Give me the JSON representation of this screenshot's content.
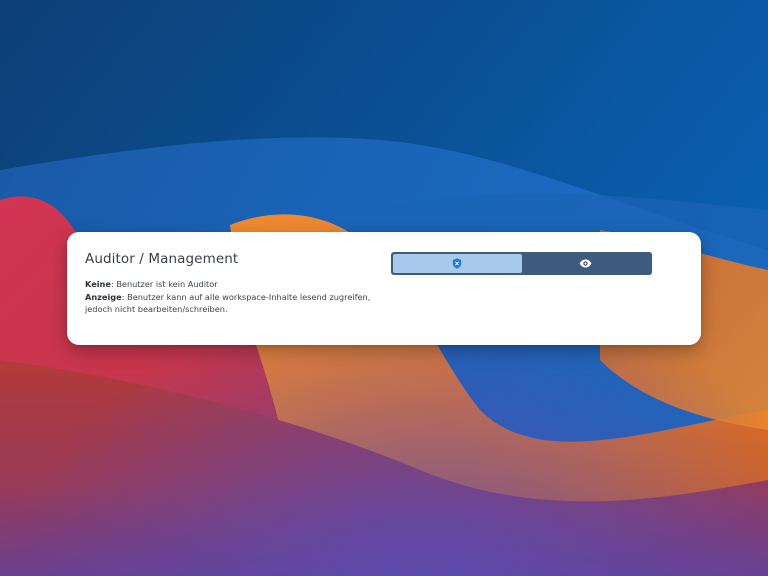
{
  "card": {
    "title": "Auditor / Management",
    "options": [
      {
        "term": "Keine",
        "description": ": Benutzer ist kein Auditor"
      },
      {
        "term": "Anzeige",
        "description": ": Benutzer kann auf alle workspace-Inhalte lesend zugreifen,"
      },
      {
        "term": "",
        "description": "jedoch nicht bearbeiten/schreiben."
      }
    ]
  },
  "toggle": {
    "segments": [
      {
        "icon": "shield-icon",
        "selected": true
      },
      {
        "icon": "eye-icon",
        "selected": false
      }
    ]
  },
  "colors": {
    "accent": "#1f7ae0",
    "segment_selected": "#a9c9ea",
    "segment_track": "#3e5a7c"
  }
}
